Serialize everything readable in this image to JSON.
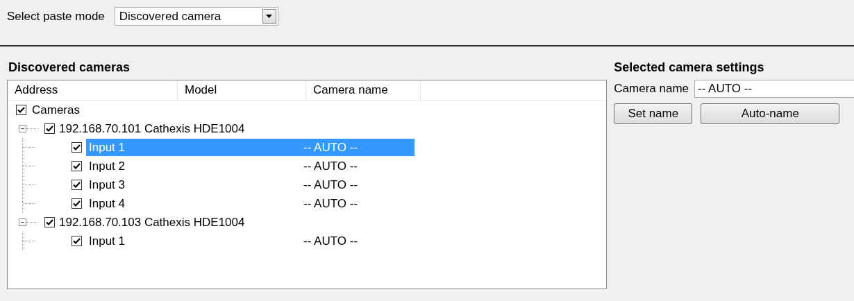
{
  "paste_mode": {
    "label": "Select paste mode",
    "value": "Discovered camera"
  },
  "discovered_cameras": {
    "title": "Discovered cameras",
    "columns": [
      "Address",
      "Model",
      "Camera name"
    ],
    "tree": {
      "label": "Cameras",
      "checked": true,
      "children": [
        {
          "label": "192.168.70.101 Cathexis HDE1004",
          "checked": true,
          "expanded": true,
          "children": [
            {
              "label": "Input 1",
              "camera_name": "-- AUTO --",
              "checked": true,
              "selected": true
            },
            {
              "label": "Input 2",
              "camera_name": "-- AUTO --",
              "checked": true,
              "selected": false
            },
            {
              "label": "Input 3",
              "camera_name": "-- AUTO --",
              "checked": true,
              "selected": false
            },
            {
              "label": "Input 4",
              "camera_name": "-- AUTO --",
              "checked": true,
              "selected": false
            }
          ]
        },
        {
          "label": "192.168.70.103 Cathexis HDE1004",
          "checked": true,
          "expanded": true,
          "children": [
            {
              "label": "Input 1",
              "camera_name": "-- AUTO --",
              "checked": true,
              "selected": false
            }
          ]
        }
      ]
    }
  },
  "selected_camera_settings": {
    "title": "Selected camera settings",
    "camera_name_label": "Camera name",
    "camera_name_value": "-- AUTO --",
    "buttons": [
      "Set name",
      "Auto-name"
    ]
  }
}
